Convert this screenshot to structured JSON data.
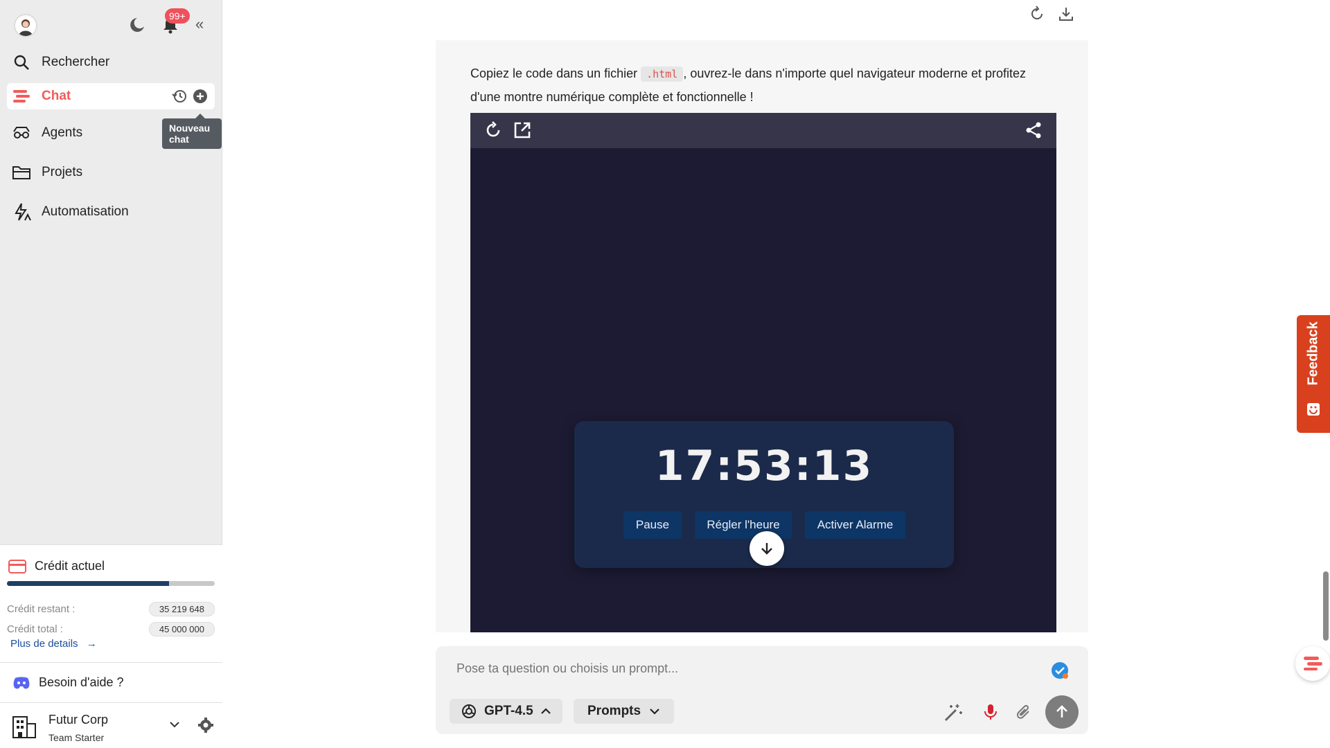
{
  "sidebar": {
    "notifications_badge": "99+",
    "nav": {
      "search": "Rechercher",
      "chat": "Chat",
      "agents": "Agents",
      "projects": "Projets",
      "automation": "Automatisation"
    },
    "tooltip": "Nouveau chat",
    "credit": {
      "title": "Crédit actuel",
      "remaining_label": "Crédit restant :",
      "remaining_value": "35 219 648",
      "total_label": "Crédit total :",
      "total_value": "45 000 000",
      "remaining_fraction": 0.78,
      "more_link": "Plus de details"
    },
    "help": "Besoin d'aide ?",
    "org": {
      "name": "Futur Corp",
      "plan": "Team Starter"
    }
  },
  "message": {
    "text_before": "Copiez le code dans un fichier ",
    "code": ".html",
    "text_after": ", ouvrez-le dans n'importe quel navigateur moderne et profitez d'une montre numérique complète et fonctionnelle !"
  },
  "preview": {
    "clock_time": "17:53:13",
    "buttons": [
      "Pause",
      "Régler l'heure",
      "Activer Alarme"
    ]
  },
  "composer": {
    "placeholder": "Pose ta question ou choisis un prompt...",
    "model": "GPT-4.5",
    "prompts": "Prompts"
  },
  "feedback": "Feedback",
  "colors": {
    "accent": "#f25b5b",
    "credit_bar": "#1e3f64",
    "feedback": "#d9411e",
    "preview_bg": "#1c1b33",
    "clock_button": "#0d3565"
  }
}
